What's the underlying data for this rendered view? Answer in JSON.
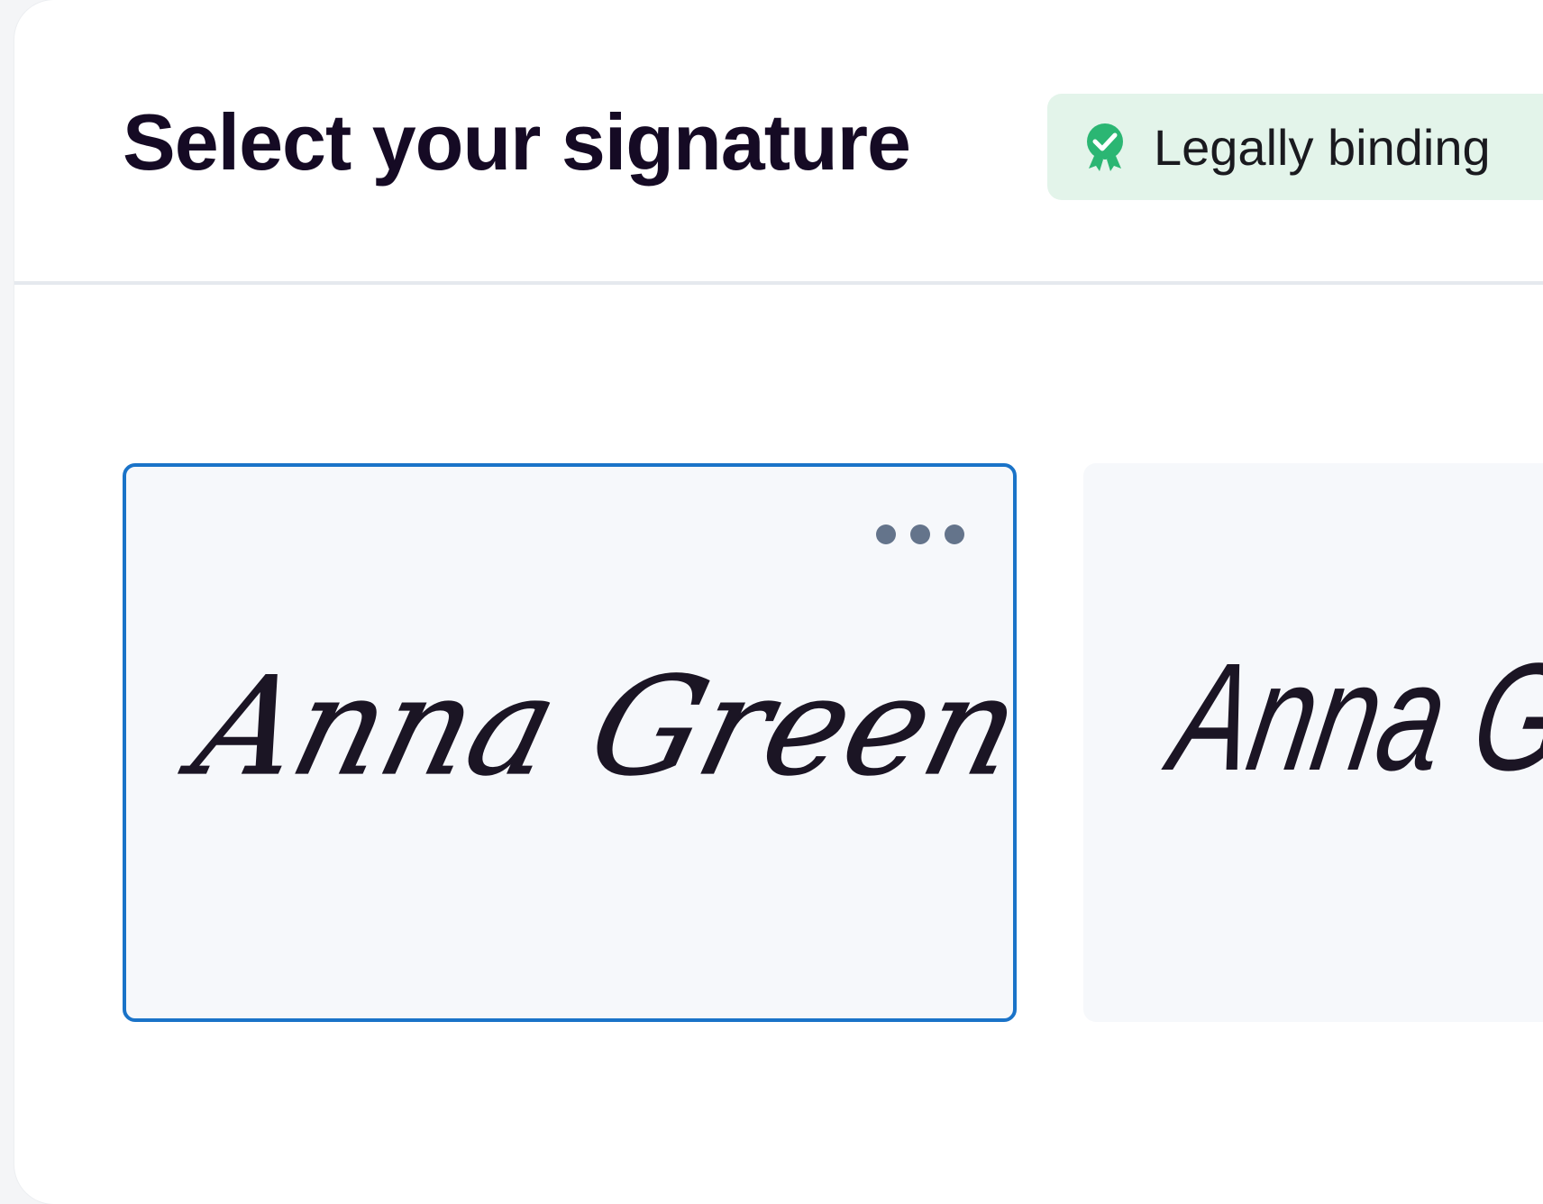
{
  "dialog": {
    "title": "Select your signature",
    "badge": {
      "label": "Legally binding",
      "icon": "verified-badge-icon",
      "color": "#2bb673"
    }
  },
  "signatures": [
    {
      "name": "Anna Green",
      "style": "script",
      "selected": true,
      "menu_icon": "more-horizontal-icon"
    },
    {
      "name": "Anna G",
      "style": "handwritten",
      "selected": false
    }
  ],
  "colors": {
    "accent": "#1a73c8",
    "badge_bg": "#e3f4ea",
    "card_bg": "#f6f8fb",
    "title": "#150a24"
  }
}
